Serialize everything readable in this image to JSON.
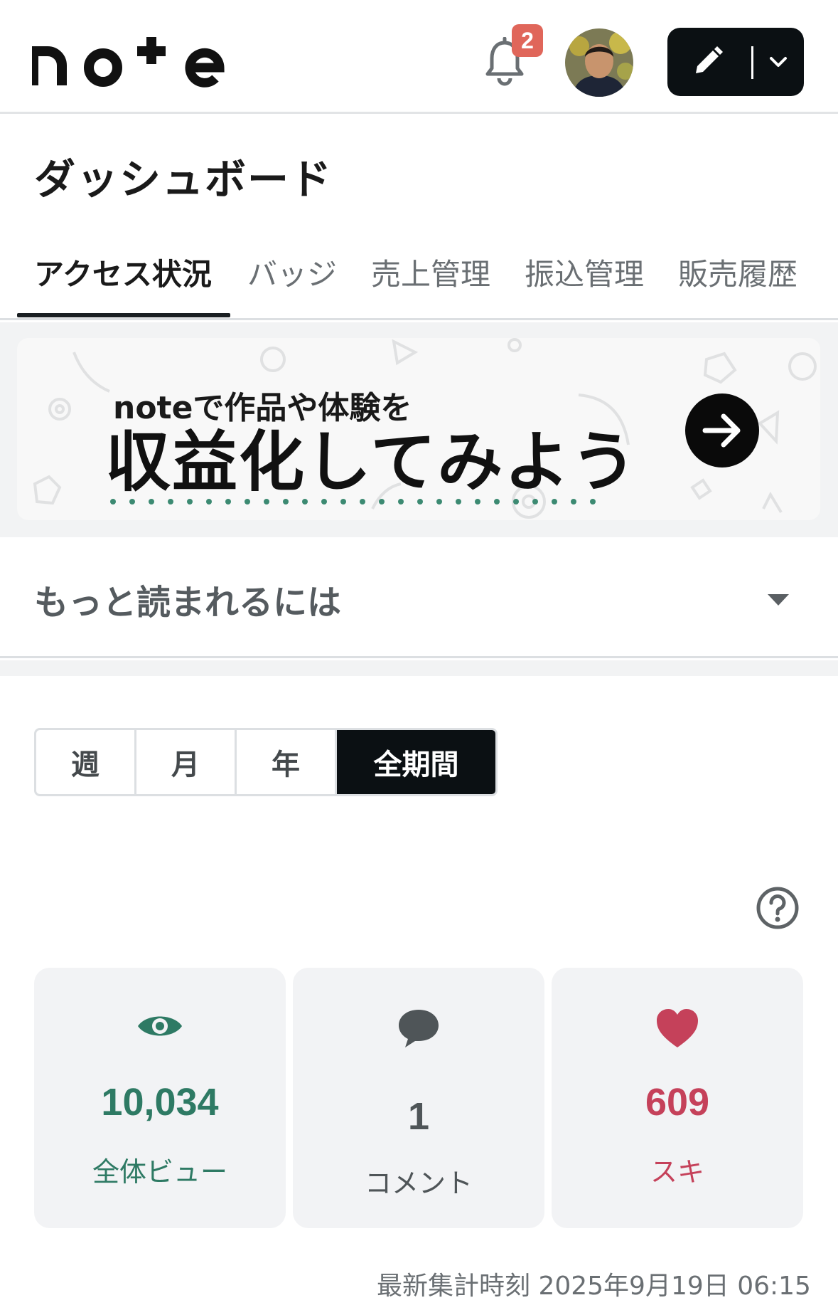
{
  "header": {
    "logo_text": "note",
    "notification_count": "2"
  },
  "page": {
    "title": "ダッシュボード"
  },
  "tabs": [
    {
      "label": "アクセス状況",
      "active": true
    },
    {
      "label": "バッジ"
    },
    {
      "label": "売上管理"
    },
    {
      "label": "振込管理"
    },
    {
      "label": "販売履歴"
    }
  ],
  "banner": {
    "subtitle": "noteで作品や体験を",
    "headline": "収益化してみよう"
  },
  "accordion": {
    "label": "もっと読まれるには"
  },
  "period": {
    "options": [
      "週",
      "月",
      "年",
      "全期間"
    ],
    "selected": "全期間"
  },
  "stats": [
    {
      "value": "10,034",
      "label": "全体ビュー",
      "icon": "eye-icon",
      "color": "#2e7a64"
    },
    {
      "value": "1",
      "label": "コメント",
      "icon": "comment-icon",
      "color": "#4f5558"
    },
    {
      "value": "609",
      "label": "スキ",
      "icon": "heart-icon",
      "color": "#c5415a"
    }
  ],
  "footer": {
    "updated": "最新集計時刻 2025年9月19日 06:15"
  },
  "colors": {
    "accent_dark": "#0b1013",
    "badge": "#e0665a",
    "view_green": "#2e7a64",
    "like_red": "#c5415a",
    "banner_dots": "#3c8a72"
  }
}
